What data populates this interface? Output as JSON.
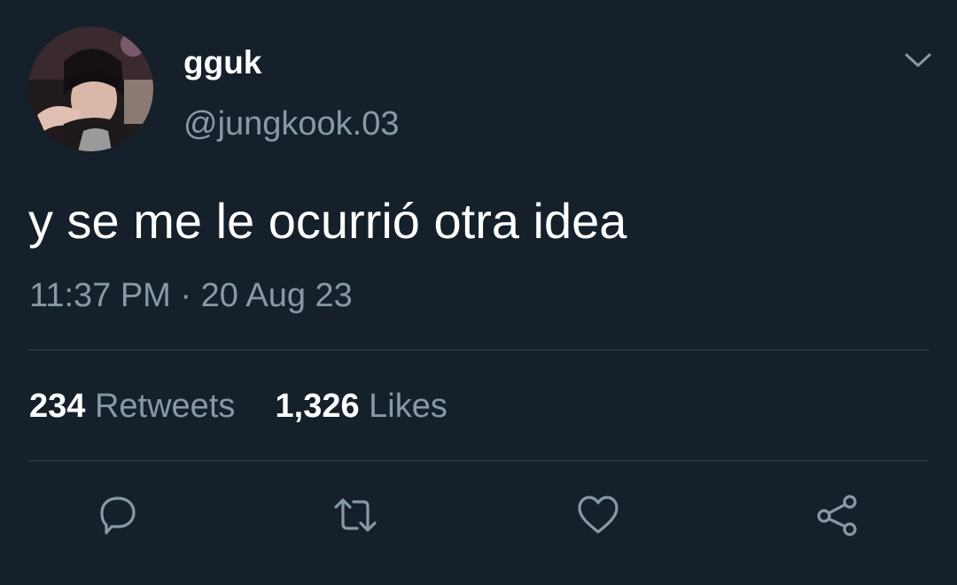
{
  "author": {
    "display_name": "gguk",
    "handle": "@jungkook.03"
  },
  "tweet": {
    "text": "y se me le ocurrió otra idea",
    "time": "11:37 PM",
    "separator": "·",
    "date": "20 Aug 23"
  },
  "stats": {
    "retweets_count": "234",
    "retweets_label": "Retweets",
    "likes_count": "1,326",
    "likes_label": "Likes"
  },
  "actions": [
    {
      "icon": "reply-icon"
    },
    {
      "icon": "retweet-icon"
    },
    {
      "icon": "like-heart-icon"
    },
    {
      "icon": "share-icon"
    }
  ],
  "colors": {
    "background": "#15202b",
    "primary_text": "#ffffff",
    "secondary_text": "#8899a6",
    "divider": "#38444d"
  }
}
